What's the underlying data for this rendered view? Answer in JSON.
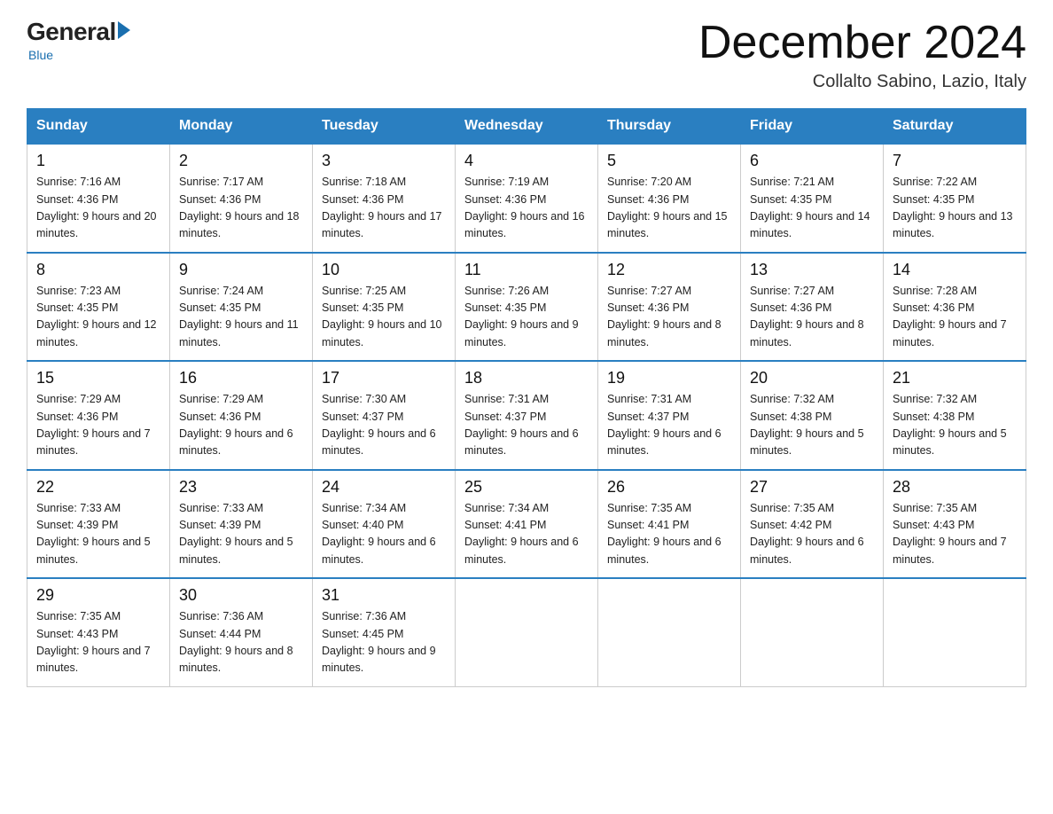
{
  "header": {
    "logo_general": "General",
    "logo_blue": "Blue",
    "logo_tagline": "Blue",
    "month_title": "December 2024",
    "location": "Collalto Sabino, Lazio, Italy"
  },
  "weekdays": [
    "Sunday",
    "Monday",
    "Tuesday",
    "Wednesday",
    "Thursday",
    "Friday",
    "Saturday"
  ],
  "weeks": [
    [
      {
        "day": 1,
        "sunrise": "7:16 AM",
        "sunset": "4:36 PM",
        "daylight": "9 hours and 20 minutes"
      },
      {
        "day": 2,
        "sunrise": "7:17 AM",
        "sunset": "4:36 PM",
        "daylight": "9 hours and 18 minutes"
      },
      {
        "day": 3,
        "sunrise": "7:18 AM",
        "sunset": "4:36 PM",
        "daylight": "9 hours and 17 minutes"
      },
      {
        "day": 4,
        "sunrise": "7:19 AM",
        "sunset": "4:36 PM",
        "daylight": "9 hours and 16 minutes"
      },
      {
        "day": 5,
        "sunrise": "7:20 AM",
        "sunset": "4:36 PM",
        "daylight": "9 hours and 15 minutes"
      },
      {
        "day": 6,
        "sunrise": "7:21 AM",
        "sunset": "4:35 PM",
        "daylight": "9 hours and 14 minutes"
      },
      {
        "day": 7,
        "sunrise": "7:22 AM",
        "sunset": "4:35 PM",
        "daylight": "9 hours and 13 minutes"
      }
    ],
    [
      {
        "day": 8,
        "sunrise": "7:23 AM",
        "sunset": "4:35 PM",
        "daylight": "9 hours and 12 minutes"
      },
      {
        "day": 9,
        "sunrise": "7:24 AM",
        "sunset": "4:35 PM",
        "daylight": "9 hours and 11 minutes"
      },
      {
        "day": 10,
        "sunrise": "7:25 AM",
        "sunset": "4:35 PM",
        "daylight": "9 hours and 10 minutes"
      },
      {
        "day": 11,
        "sunrise": "7:26 AM",
        "sunset": "4:35 PM",
        "daylight": "9 hours and 9 minutes"
      },
      {
        "day": 12,
        "sunrise": "7:27 AM",
        "sunset": "4:36 PM",
        "daylight": "9 hours and 8 minutes"
      },
      {
        "day": 13,
        "sunrise": "7:27 AM",
        "sunset": "4:36 PM",
        "daylight": "9 hours and 8 minutes"
      },
      {
        "day": 14,
        "sunrise": "7:28 AM",
        "sunset": "4:36 PM",
        "daylight": "9 hours and 7 minutes"
      }
    ],
    [
      {
        "day": 15,
        "sunrise": "7:29 AM",
        "sunset": "4:36 PM",
        "daylight": "9 hours and 7 minutes"
      },
      {
        "day": 16,
        "sunrise": "7:29 AM",
        "sunset": "4:36 PM",
        "daylight": "9 hours and 6 minutes"
      },
      {
        "day": 17,
        "sunrise": "7:30 AM",
        "sunset": "4:37 PM",
        "daylight": "9 hours and 6 minutes"
      },
      {
        "day": 18,
        "sunrise": "7:31 AM",
        "sunset": "4:37 PM",
        "daylight": "9 hours and 6 minutes"
      },
      {
        "day": 19,
        "sunrise": "7:31 AM",
        "sunset": "4:37 PM",
        "daylight": "9 hours and 6 minutes"
      },
      {
        "day": 20,
        "sunrise": "7:32 AM",
        "sunset": "4:38 PM",
        "daylight": "9 hours and 5 minutes"
      },
      {
        "day": 21,
        "sunrise": "7:32 AM",
        "sunset": "4:38 PM",
        "daylight": "9 hours and 5 minutes"
      }
    ],
    [
      {
        "day": 22,
        "sunrise": "7:33 AM",
        "sunset": "4:39 PM",
        "daylight": "9 hours and 5 minutes"
      },
      {
        "day": 23,
        "sunrise": "7:33 AM",
        "sunset": "4:39 PM",
        "daylight": "9 hours and 5 minutes"
      },
      {
        "day": 24,
        "sunrise": "7:34 AM",
        "sunset": "4:40 PM",
        "daylight": "9 hours and 6 minutes"
      },
      {
        "day": 25,
        "sunrise": "7:34 AM",
        "sunset": "4:41 PM",
        "daylight": "9 hours and 6 minutes"
      },
      {
        "day": 26,
        "sunrise": "7:35 AM",
        "sunset": "4:41 PM",
        "daylight": "9 hours and 6 minutes"
      },
      {
        "day": 27,
        "sunrise": "7:35 AM",
        "sunset": "4:42 PM",
        "daylight": "9 hours and 6 minutes"
      },
      {
        "day": 28,
        "sunrise": "7:35 AM",
        "sunset": "4:43 PM",
        "daylight": "9 hours and 7 minutes"
      }
    ],
    [
      {
        "day": 29,
        "sunrise": "7:35 AM",
        "sunset": "4:43 PM",
        "daylight": "9 hours and 7 minutes"
      },
      {
        "day": 30,
        "sunrise": "7:36 AM",
        "sunset": "4:44 PM",
        "daylight": "9 hours and 8 minutes"
      },
      {
        "day": 31,
        "sunrise": "7:36 AM",
        "sunset": "4:45 PM",
        "daylight": "9 hours and 9 minutes"
      },
      null,
      null,
      null,
      null
    ]
  ]
}
